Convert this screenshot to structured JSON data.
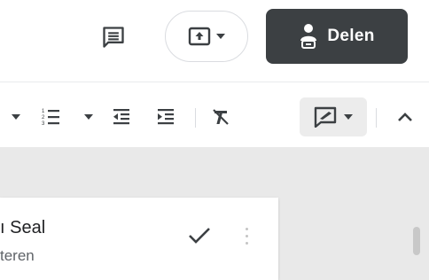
{
  "header": {
    "comments_icon": "comment-icon",
    "present_icon": "present-upload-icon",
    "present_dropdown_icon": "caret-down-icon",
    "share": {
      "label": "Delen",
      "icon": "share-lock-person-icon",
      "background": "#3c4043"
    }
  },
  "toolbar": {
    "items": [
      "caret-down-icon",
      "numbered-list-icon",
      "caret-down-icon",
      "decrease-indent-icon",
      "increase-indent-icon",
      "clear-formatting-icon",
      "highlight-pen-icon",
      "caret-down-icon",
      "chevron-up-icon"
    ]
  },
  "comment_card": {
    "name": "ı Seal",
    "subtitle": "teren",
    "resolve_icon": "checkmark-icon",
    "more_icon": "more-vert-icon"
  },
  "colors": {
    "canvas": "#e9e9e9",
    "text": "#3c4043"
  }
}
